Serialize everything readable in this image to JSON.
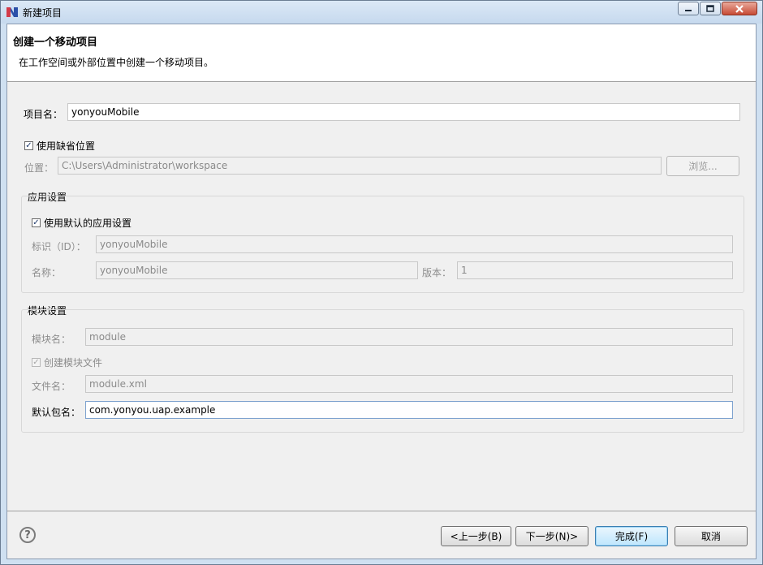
{
  "window": {
    "title": "新建项目"
  },
  "banner": {
    "title": "创建一个移动项目",
    "message": "在工作空间或外部位置中创建一个移动项目。"
  },
  "project": {
    "name_label": "项目名：",
    "name_value": "yonyouMobile"
  },
  "location": {
    "use_default_label": "使用缺省位置",
    "use_default_checked": true,
    "label": "位置：",
    "value": "C:\\Users\\Administrator\\workspace",
    "browse_label": "浏览..."
  },
  "app_settings": {
    "group_label": "应用设置",
    "use_default_label": "使用默认的应用设置",
    "use_default_checked": true,
    "id_label": "标识（ID）：",
    "id_value": "yonyouMobile",
    "name_label": "名称：",
    "name_value": "yonyouMobile",
    "version_label": "版本：",
    "version_value": "1"
  },
  "module_settings": {
    "group_label": "模块设置",
    "module_name_label": "模块名：",
    "module_name_value": "module",
    "create_file_label": "创建模块文件",
    "create_file_checked": true,
    "file_name_label": "文件名：",
    "file_name_value": "module.xml",
    "package_label": "默认包名：",
    "package_value": "com.yonyou.uap.example"
  },
  "buttons": {
    "back": "<上一步(B)",
    "next": "下一步(N)>",
    "finish": "完成(F)",
    "cancel": "取消"
  },
  "help": {
    "glyph": "?"
  },
  "colors": {
    "accent": "#3c7fb1",
    "title_bg": "#c6d9ee",
    "close": "#c74a35"
  }
}
